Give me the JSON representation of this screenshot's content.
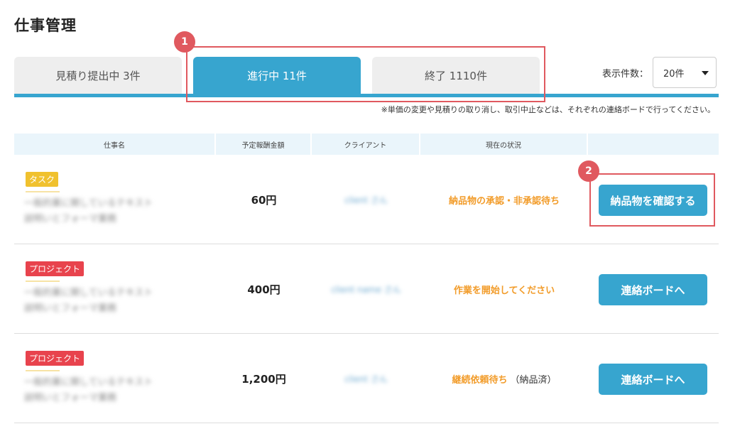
{
  "page": {
    "title": "仕事管理"
  },
  "tabs": [
    {
      "label": "見積り提出中 3件",
      "active": false
    },
    {
      "label": "進行中 11件",
      "active": true
    },
    {
      "label": "終了 1110件",
      "active": false
    }
  ],
  "display_count": {
    "label": "表示件数：",
    "value": "20件"
  },
  "note": "※単価の変更や見積りの取り消し、取引中止などは、それぞれの連絡ボードで行ってください。",
  "table": {
    "columns": [
      "仕事名",
      "予定報酬金額",
      "クライアント",
      "現在の状況",
      ""
    ],
    "rows": [
      {
        "badge": "タスク",
        "badge_type": "task",
        "price": "60円",
        "status": "納品物の承認・非承認待ち",
        "status_note": "",
        "action": "納品物を確認する"
      },
      {
        "badge": "プロジェクト",
        "badge_type": "project",
        "price": "400円",
        "status": "作業を開始してください",
        "status_note": "",
        "action": "連絡ボードへ"
      },
      {
        "badge": "プロジェクト",
        "badge_type": "project",
        "price": "1,200円",
        "status": "継続依頼待ち",
        "status_note": "（納品済）",
        "action": "連絡ボードへ"
      }
    ]
  },
  "annotations": {
    "marker_1": "1",
    "marker_2": "2"
  },
  "colors": {
    "accent": "#37a5cf",
    "status": "#f29c2a",
    "task_badge": "#f0c12e",
    "project_badge": "#e8434d",
    "highlight": "#e0595f"
  }
}
